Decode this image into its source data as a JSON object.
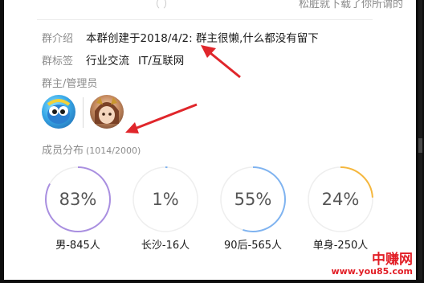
{
  "top_snippet": {
    "left_text": "（ ）",
    "right_text": "松脏就下载了你所谓的"
  },
  "intro": {
    "label": "群介绍",
    "text": "本群创建于2018/4/2: 群主很懒,什么都没有留下"
  },
  "tags": {
    "label": "群标签",
    "items": [
      "行业交流",
      "IT/互联网"
    ]
  },
  "admins": {
    "title": "群主/管理员"
  },
  "members": {
    "title": "成员分布",
    "count": "(1014/2000)",
    "stats": [
      {
        "percent_text": "83%",
        "fraction": 0.83,
        "label": "男-845人",
        "color": "#a98fe0"
      },
      {
        "percent_text": "1%",
        "fraction": 0.01,
        "label": "长沙-16人",
        "color": "#7fb3f0"
      },
      {
        "percent_text": "55%",
        "fraction": 0.55,
        "label": "90后-565人",
        "color": "#7fb3f0"
      },
      {
        "percent_text": "24%",
        "fraction": 0.24,
        "label": "单身-250人",
        "color": "#f5b73d"
      }
    ]
  },
  "watermark": {
    "cn": "中赚网",
    "url": "www.you85.com"
  }
}
